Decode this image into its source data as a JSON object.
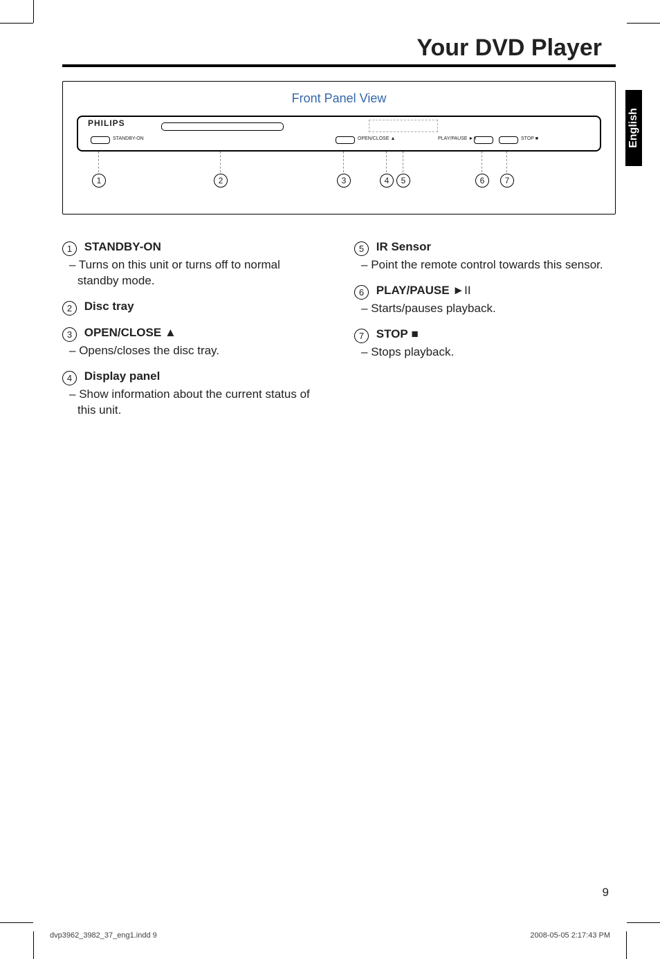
{
  "title": "Your DVD Player",
  "lang_tab": "English",
  "diagram": {
    "caption": "Front Panel View",
    "brand": "PHILIPS",
    "labels": {
      "standby": "STANDBY-ON",
      "openclose": "OPEN/CLOSE ▲",
      "playpause": "PLAY/PAUSE ►II",
      "stop": "STOP ■"
    },
    "callout_numbers": [
      "1",
      "2",
      "3",
      "4",
      "5",
      "6",
      "7"
    ]
  },
  "left_items": [
    {
      "num": "1",
      "head": "STANDBY-ON",
      "sym": "",
      "desc": "Turns on this unit or turns off to normal standby mode."
    },
    {
      "num": "2",
      "head": "Disc tray",
      "sym": "",
      "desc": null
    },
    {
      "num": "3",
      "head": "OPEN/CLOSE",
      "sym": "▲",
      "desc": "Opens/closes the disc tray."
    },
    {
      "num": "4",
      "head": "Display panel",
      "sym": "",
      "desc": "Show information about the current status of this unit."
    }
  ],
  "right_items": [
    {
      "num": "5",
      "head": "IR Sensor",
      "sym": "",
      "desc": "Point the remote control towards this sensor."
    },
    {
      "num": "6",
      "head": "PLAY/PAUSE",
      "sym": "►II",
      "desc": "Starts/pauses playback."
    },
    {
      "num": "7",
      "head": "STOP",
      "sym": "■",
      "desc": "Stops playback."
    }
  ],
  "page_number": "9",
  "footer_left": "dvp3962_3982_37_eng1.indd   9",
  "footer_right": "2008-05-05   2:17:43 PM"
}
